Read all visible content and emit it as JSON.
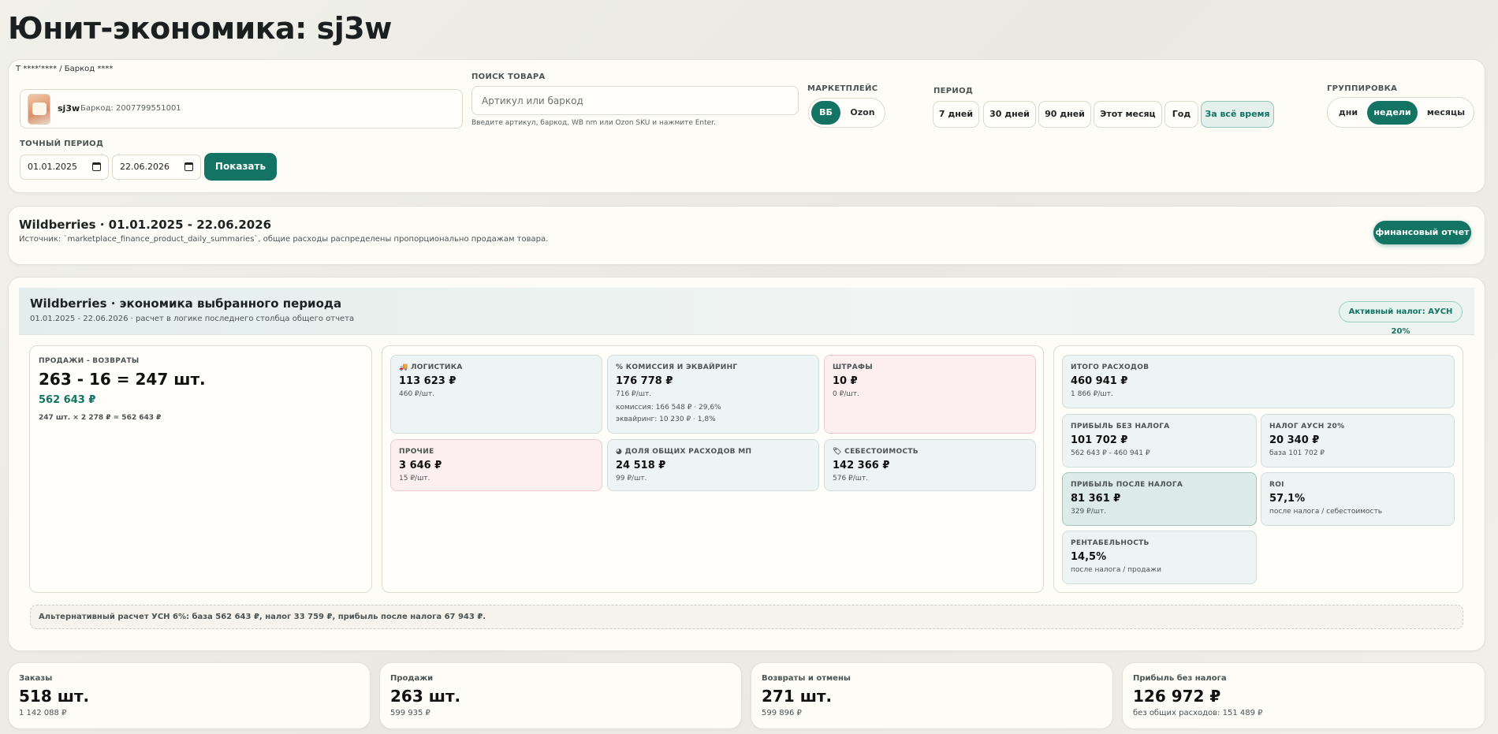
{
  "page": {
    "title": "Юнит-экономика: sj3w"
  },
  "controls": {
    "breadcrumb": "Т ****'**** / Баркод ****",
    "product": {
      "name": "sj3w",
      "barcode": "Баркод: 2007799551001"
    },
    "search": {
      "label": "ПОИСК ТОВАРА",
      "placeholder": "Артикул или баркод",
      "hint": "Введите артикул, баркод, WB nm или Ozon SKU и нажмите Enter."
    },
    "marketplace": {
      "label": "МАРКЕТПЛЕЙС",
      "options": [
        "ВБ",
        "Ozon"
      ],
      "selected": "ВБ"
    },
    "period": {
      "label": "ПЕРИОД",
      "options": [
        "7 дней",
        "30 дней",
        "90 дней",
        "Этот месяц",
        "Год",
        "За всё время"
      ],
      "selected": "За всё время"
    },
    "grouping": {
      "label": "ГРУППИРОВКА",
      "options": [
        "дни",
        "недели",
        "месяцы"
      ],
      "selected": "недели"
    },
    "exact_period": {
      "label": "ТОЧНЫЙ ПЕРИОД",
      "from": "01.01.2025",
      "to": "22.06.2026"
    },
    "show_button": "Показать"
  },
  "info": {
    "title": "Wildberries · 01.01.2025 - 22.06.2026",
    "source": "Источник: `marketplace_finance_product_daily_summaries`, общие расходы распределены пропорционально продажам товара.",
    "finance_button": "финансовый отчет"
  },
  "economics": {
    "title": "Wildberries · экономика выбранного периода",
    "subtitle": "01.01.2025 - 22.06.2026 · расчет в логике последнего столбца общего отчета",
    "tax_badge": "Активный налог: АУСН 20%",
    "sales": {
      "caption": "ПРОДАЖИ - ВОЗВРАТЫ",
      "formula": "263 - 16 = 247 шт.",
      "amount": "562 643 ₽",
      "detail": "247 шт. × 2 278 ₽ = 562 643 ₽"
    },
    "expenses": [
      {
        "caption": "ЛОГИСТИКА",
        "icon": "truck-icon",
        "value": "113 623 ₽",
        "note": "460 ₽/шт.",
        "tone": "neutral"
      },
      {
        "caption": "КОМИССИЯ И ЭКВАЙРИНГ",
        "icon": "percent-icon",
        "value": "176 778 ₽",
        "note": "716 ₽/шт.",
        "note2": "комиссия: 166 548 ₽ · 29,6%",
        "note3": "эквайринг: 10 230 ₽ · 1,8%",
        "tone": "neutral"
      },
      {
        "caption": "ШТРАФЫ",
        "value": "10 ₽",
        "note": "0 ₽/шт.",
        "tone": "pink"
      },
      {
        "caption": "ПРОЧИЕ",
        "value": "3 646 ₽",
        "note": "15 ₽/шт.",
        "tone": "pink"
      },
      {
        "caption": "ДОЛЯ ОБЩИХ РАСХОДОВ МП",
        "icon": "pie-icon",
        "value": "24 518 ₽",
        "note": "99 ₽/шт.",
        "tone": "neutral"
      },
      {
        "caption": "СЕБЕСТОИМОСТЬ",
        "icon": "tag-icon",
        "value": "142 366 ₽",
        "note": "576 ₽/шт.",
        "tone": "neutral"
      }
    ],
    "summary": {
      "total": {
        "caption": "ИТОГО РАСХОДОВ",
        "value": "460 941 ₽",
        "note": "1 866 ₽/шт."
      },
      "profit_pre_tax": {
        "caption": "ПРИБЫЛЬ БЕЗ НАЛОГА",
        "value": "101 702 ₽",
        "note": "562 643 ₽ - 460 941 ₽"
      },
      "tax": {
        "caption": "НАЛОГ АУСН 20%",
        "value": "20 340 ₽",
        "note": "база 101 702 ₽"
      },
      "profit_after_tax": {
        "caption": "ПРИБЫЛЬ ПОСЛЕ НАЛОГА",
        "value": "81 361 ₽",
        "note": "329 ₽/шт."
      },
      "roi": {
        "caption": "ROI",
        "value": "57,1%",
        "note": "после налога / себестоимость"
      },
      "margin": {
        "caption": "РЕНТАБЕЛЬНОСТЬ",
        "value": "14,5%",
        "note": "после налога / продажи"
      }
    },
    "alt_calc": "Альтернативный расчет УСН 6%: база 562 643 ₽, налог 33 759 ₽, прибыль после налога 67 943 ₽."
  },
  "stats": [
    {
      "label": "Заказы",
      "value": "518 шт.",
      "sub": "1 142 088 ₽"
    },
    {
      "label": "Продажи",
      "value": "263 шт.",
      "sub": "599 935 ₽"
    },
    {
      "label": "Возвраты и отмены",
      "value": "271 шт.",
      "sub": "599 896 ₽"
    },
    {
      "label": "Прибыль без налога",
      "value": "126 972 ₽",
      "sub": "без общих расходов: 151 489 ₽"
    }
  ],
  "colors": {
    "accent": "#137463",
    "background": "#f1f0eb",
    "card": "#fdfcf7",
    "pink_tile": "#fdeff0",
    "teal_tile": "#eef4f3"
  }
}
